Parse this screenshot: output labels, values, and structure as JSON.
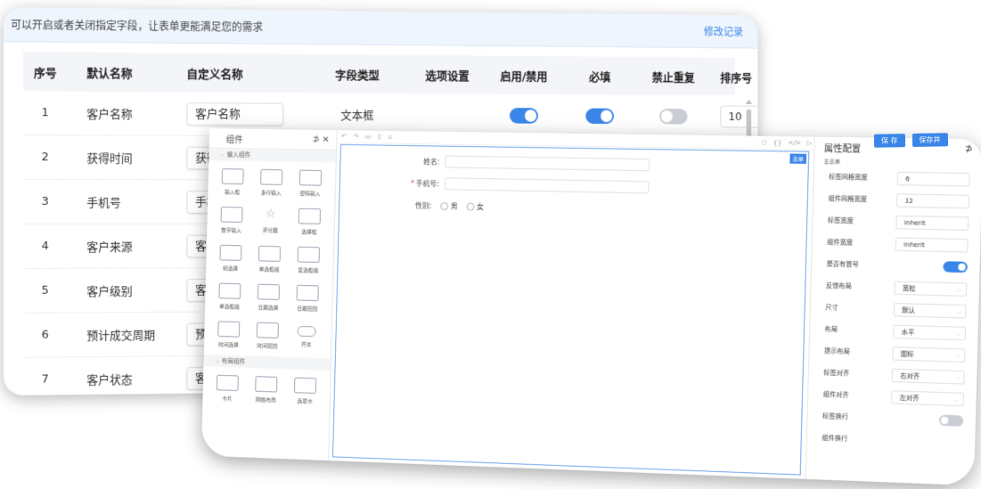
{
  "notice": {
    "text": "可以开启或者关闭指定字段，让表单更能满足您的需求",
    "link": "修改记录"
  },
  "table": {
    "headers": [
      "序号",
      "默认名称",
      "自定义名称",
      "字段类型",
      "选项设置",
      "启用/禁用",
      "必填",
      "禁止重复",
      "排序号"
    ],
    "rows": [
      {
        "no": "1",
        "default_name": "客户名称",
        "custom_name": "客户名称",
        "type": "文本框",
        "enabled": true,
        "required": true,
        "unique": false,
        "sort": "10"
      },
      {
        "no": "2",
        "default_name": "获得时间",
        "custom_name": "获得时间"
      },
      {
        "no": "3",
        "default_name": "手机号",
        "custom_name": "手机号"
      },
      {
        "no": "4",
        "default_name": "客户来源",
        "custom_name": "客户来源"
      },
      {
        "no": "5",
        "default_name": "客户级别",
        "custom_name": "客户级别"
      },
      {
        "no": "6",
        "default_name": "预计成交周期",
        "custom_name": "预计成"
      },
      {
        "no": "7",
        "default_name": "客户状态",
        "custom_name": "客"
      }
    ]
  },
  "designer": {
    "palette_title": "组件",
    "group_input": "输入组件",
    "group_layout": "布局组件",
    "input_components": [
      "输入框",
      "多行输入",
      "密码输入",
      "数字输入",
      "评分器",
      "选择框",
      "树选择",
      "单选框组",
      "复选框组",
      "单选框组",
      "日期选择",
      "日期范围",
      "时间选择",
      "时间范围",
      "开关"
    ],
    "layout_components": [
      "卡片",
      "网格布局",
      "选项卡"
    ],
    "canvas_tag": "表单",
    "form": {
      "name_label": "姓名:",
      "phone_label": "手机号:",
      "gender_label": "性别:",
      "gender_options": [
        "男",
        "女"
      ]
    },
    "buttons": {
      "save": "保 存",
      "save_as": "保存并"
    },
    "props": {
      "title": "属性配置",
      "tab": "主表单",
      "rows": [
        {
          "label": "标签网格宽度",
          "value": "6"
        },
        {
          "label": "组件网格宽度",
          "value": "12"
        },
        {
          "label": "标签宽度",
          "value": "inherit"
        },
        {
          "label": "组件宽度",
          "value": "inherit"
        }
      ],
      "has_colon_label": "是否有冒号",
      "selects": [
        {
          "label": "反馈布局",
          "value": "宽松"
        },
        {
          "label": "尺寸",
          "value": "默认"
        },
        {
          "label": "布局",
          "value": "水平"
        },
        {
          "label": "提示布局",
          "value": "图标"
        },
        {
          "label": "标签对齐",
          "value": "右对齐"
        },
        {
          "label": "组件对齐",
          "value": "左对齐"
        }
      ],
      "label_wrap": "标签换行",
      "comp_wrap": "组件换行"
    }
  },
  "colors": {
    "accent": "#3a86e8",
    "notice_bg": "#eef5fd",
    "switch_off": "#c9cdd4"
  }
}
